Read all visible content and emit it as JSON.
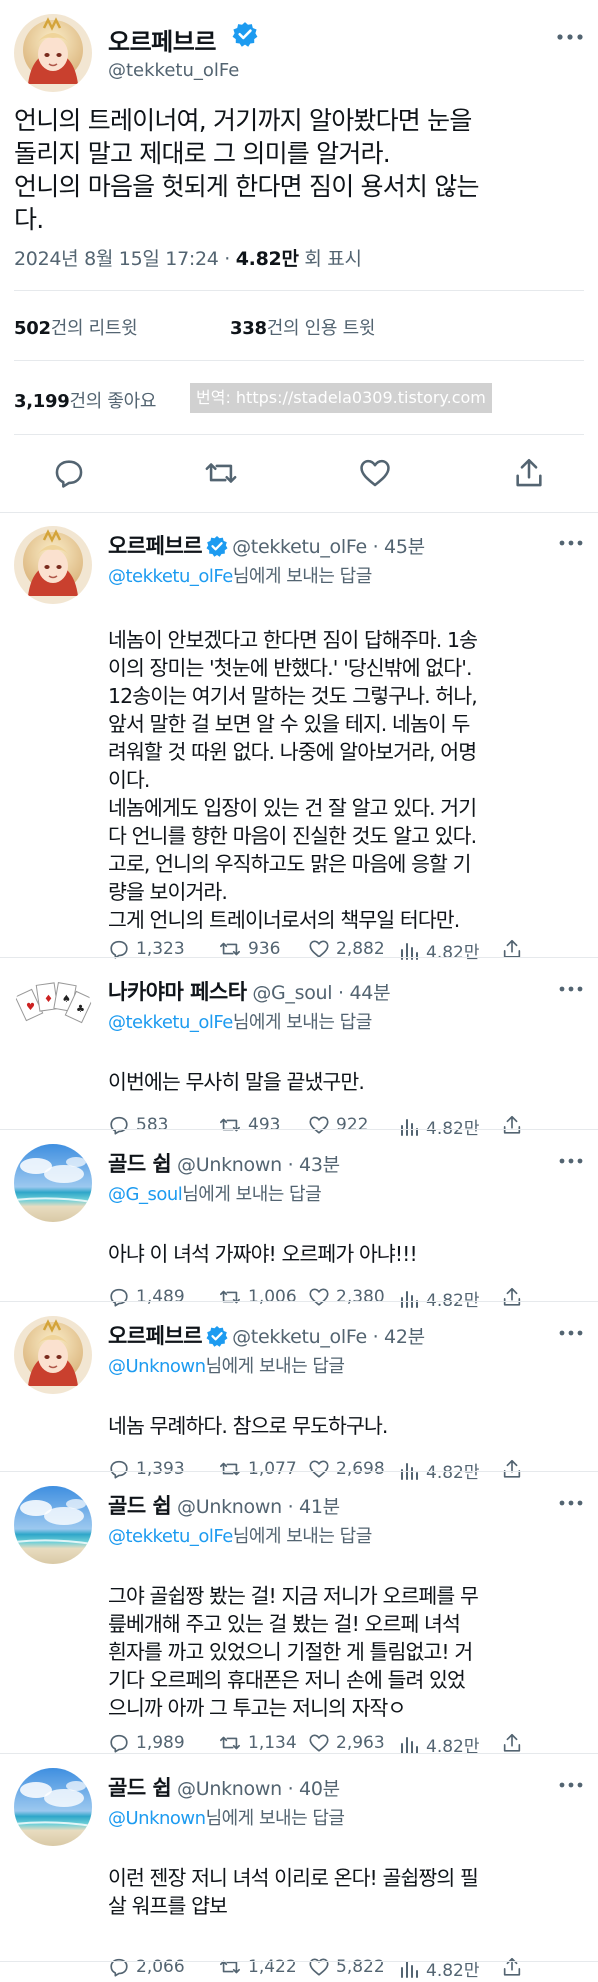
{
  "main": {
    "name": "오르페브르",
    "handle": "@tekketu_olFe",
    "lines": [
      "언니의 트레이너여, 거기까지 알아봤다면 눈을",
      "돌리지 말고 제대로 그 의미를 알거라.",
      "언니의 마음을 헛되게 한다면 짐이 용서치 않는",
      "다."
    ],
    "datetime": "2024년 8월 15일 17:24 · ",
    "views": "4.82만",
    "views_label": " 회 표시",
    "retweets": "502",
    "retweets_label": "건의 리트윗",
    "quotes": "338",
    "quotes_label": "건의 인용 트윗",
    "likes": "3,199",
    "likes_label": "건의 좋아요",
    "watermark": "번역: https://stadela0309.tistory.com"
  },
  "replying_suffix": "님에게 보내는 답글",
  "replies": [
    {
      "name": "오르페브르",
      "handle": "@tekketu_olFe",
      "time": " · 45분",
      "to": "@tekketu_olFe",
      "lines": [
        "네놈이 안보겠다고 한다면 짐이 답해주마. 1송",
        "이의 장미는 '첫눈에 반했다.' '당신밖에 없다'.",
        "12송이는 여기서 말하는 것도 그렇구나. 허나,",
        "앞서 말한 걸 보면 알 수 있을 테지. 네놈이 두",
        "려워할 것 따윈 없다. 나중에 알아보거라, 어명",
        "이다.",
        "네놈에게도 입장이 있는 건 잘 알고 있다. 거기",
        "다 언니를 향한 마음이 진실한 것도 알고 있다.",
        "고로, 언니의 우직하고도 맑은 마음에 응할 기",
        "량을 보이거라.",
        "그게 언니의 트레이너로서의 책무일 터다만."
      ],
      "comments": "1,323",
      "retweets": "936",
      "likes": "2,882",
      "views": "4.82만"
    },
    {
      "name": "나카야마 페스타",
      "handle": "@G_soul",
      "time": " · 44분",
      "to": "@tekketu_olFe",
      "lines": [
        "이번에는 무사히 말을 끝냈구만."
      ],
      "comments": "583",
      "retweets": "493",
      "likes": "922",
      "views": "4.82만"
    },
    {
      "name": "골드 쉽",
      "handle": "@Unknown",
      "time": " · 43분",
      "to": "@G_soul",
      "lines": [
        "아냐 이 녀석 가짜야! 오르페가 아냐!!!"
      ],
      "comments": "1,489",
      "retweets": "1,006",
      "likes": "2,380",
      "views": "4.82만"
    },
    {
      "name": "오르페브르",
      "handle": "@tekketu_olFe",
      "time": " · 42분",
      "to": "@Unknown",
      "lines": [
        "네놈 무례하다. 참으로 무도하구나."
      ],
      "comments": "1,393",
      "retweets": "1,077",
      "likes": "2,698",
      "views": "4.82만"
    },
    {
      "name": "골드 쉽",
      "handle": "@Unknown",
      "time": " · 41분",
      "to": "@tekketu_olFe",
      "lines": [
        "그야 골쉽짱 봤는 걸! 지금 저니가 오르페를 무",
        "릎베개해 주고 있는 걸 봤는 걸! 오르페 녀석",
        "흰자를 까고 있었으니 기절한 게 틀림없고! 거",
        "기다 오르페의 휴대폰은 저니 손에 들려 있었",
        "으니까 아까 그 투고는 저니의 자작ㅇ"
      ],
      "comments": "1,989",
      "retweets": "1,134",
      "likes": "2,963",
      "views": "4.82만"
    },
    {
      "name": "골드 쉽",
      "handle": "@Unknown",
      "time": " · 40분",
      "to": "@Unknown",
      "lines": [
        "이런 젠장 저니 녀석 이리로 온다! 골쉽짱의 필",
        "살 워프를 얍보"
      ],
      "comments": "2,066",
      "retweets": "1,422",
      "likes": "5,822",
      "views": "4.82만"
    }
  ],
  "colors": {
    "verified": "#1d9bf0",
    "link": "#1d9bf0",
    "secondary": "#536471"
  }
}
